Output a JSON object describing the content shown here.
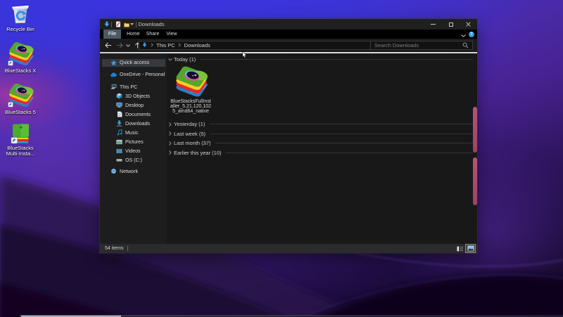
{
  "colors": {
    "wallpaper_blue": "#3d35d6",
    "wallpaper_purple": "#452699",
    "accent_blue": "#2f8cd0",
    "file_tab_bg": "#4d5a66",
    "selection_bg": "#36393e",
    "pink_edge": "#b85677"
  },
  "desktop": {
    "icons": [
      {
        "label": "Recycle Bin"
      },
      {
        "label": "BlueStacks X"
      },
      {
        "label": "BlueStacks 5"
      },
      {
        "label_line1": "BlueStacks",
        "label_line2": "Multi-Insta..."
      }
    ]
  },
  "window": {
    "titlebar": {
      "title": "Downloads"
    },
    "ribbon": {
      "help_glyph": "?",
      "tabs": [
        {
          "label": "File"
        },
        {
          "label": "Home"
        },
        {
          "label": "Share"
        },
        {
          "label": "View"
        }
      ]
    },
    "navbar": {
      "breadcrumb": {
        "root": "This PC",
        "current": "Downloads"
      },
      "search_placeholder": "Search Downloads"
    },
    "sidebar": {
      "items": [
        {
          "label": "Quick access"
        },
        {
          "label": "OneDrive - Personal"
        },
        {
          "label": "This PC"
        },
        {
          "label": "3D Objects"
        },
        {
          "label": "Desktop"
        },
        {
          "label": "Documents"
        },
        {
          "label": "Downloads"
        },
        {
          "label": "Music"
        },
        {
          "label": "Pictures"
        },
        {
          "label": "Videos"
        },
        {
          "label": "OS (C:)"
        },
        {
          "label": "Network"
        }
      ]
    },
    "main": {
      "groups": [
        {
          "label": "Today (1)"
        },
        {
          "label": "Yesterday (1)"
        },
        {
          "label": "Last week (5)"
        },
        {
          "label": "Last month (37)"
        },
        {
          "label": "Earlier this year (10)"
        }
      ],
      "file": {
        "name_line1": "BlueStacksFullInst",
        "name_line2": "aller_5.21.120.102",
        "name_line3": "5_amd64_native"
      }
    },
    "statusbar": {
      "items_count": "54 items"
    }
  }
}
